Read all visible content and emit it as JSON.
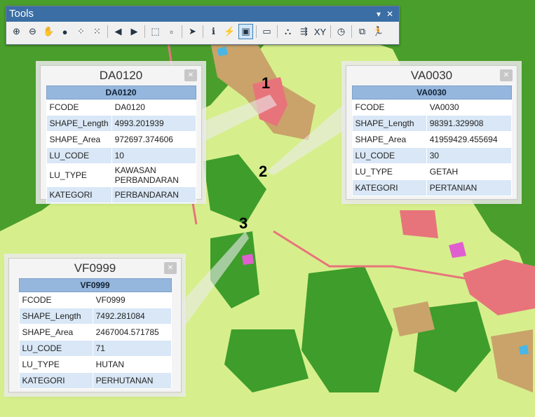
{
  "toolbar": {
    "title": "Tools",
    "menu_glyph": "▾",
    "close_glyph": "✕",
    "buttons": [
      {
        "name": "zoom-in-icon",
        "glyph": "⊕"
      },
      {
        "name": "zoom-out-icon",
        "glyph": "⊖"
      },
      {
        "name": "pan-icon",
        "glyph": "✋"
      },
      {
        "name": "full-extent-icon",
        "glyph": "●"
      },
      {
        "name": "fixed-zoom-in-icon",
        "glyph": "⁘"
      },
      {
        "name": "fixed-zoom-out-icon",
        "glyph": "⁙"
      },
      {
        "name": "sep"
      },
      {
        "name": "back-extent-icon",
        "glyph": "◀"
      },
      {
        "name": "forward-extent-icon",
        "glyph": "▶"
      },
      {
        "name": "sep"
      },
      {
        "name": "select-features-icon",
        "glyph": "⬚"
      },
      {
        "name": "clear-selection-icon",
        "glyph": "▫"
      },
      {
        "name": "sep"
      },
      {
        "name": "select-elements-icon",
        "glyph": "➤"
      },
      {
        "name": "sep"
      },
      {
        "name": "identify-icon",
        "glyph": "ℹ"
      },
      {
        "name": "hyperlink-icon",
        "glyph": "⚡"
      },
      {
        "name": "html-popup-icon",
        "glyph": "▣",
        "active": true
      },
      {
        "name": "sep"
      },
      {
        "name": "measure-icon",
        "glyph": "▭"
      },
      {
        "name": "sep"
      },
      {
        "name": "find-icon",
        "glyph": "⛬"
      },
      {
        "name": "find-route-icon",
        "glyph": "⇶"
      },
      {
        "name": "go-to-xy-icon",
        "glyph": "XY"
      },
      {
        "name": "sep"
      },
      {
        "name": "time-slider-icon",
        "glyph": "◷"
      },
      {
        "name": "sep"
      },
      {
        "name": "viewer-window-icon",
        "glyph": "⧉"
      },
      {
        "name": "route-runner-icon",
        "glyph": "🏃"
      }
    ]
  },
  "popups": [
    {
      "title": "DA0120",
      "header": "DA0120",
      "rows": [
        {
          "field": "FCODE",
          "value": "DA0120"
        },
        {
          "field": "SHAPE_Length",
          "value": "4993.201939"
        },
        {
          "field": "SHAPE_Area",
          "value": "972697.374606"
        },
        {
          "field": "LU_CODE",
          "value": "10"
        },
        {
          "field": "LU_TYPE",
          "value": "KAWASAN PERBANDARAN"
        },
        {
          "field": "KATEGORI",
          "value": "PERBANDARAN"
        }
      ]
    },
    {
      "title": "VA0030",
      "header": "VA0030",
      "rows": [
        {
          "field": "FCODE",
          "value": "VA0030"
        },
        {
          "field": "SHAPE_Length",
          "value": "98391.329908"
        },
        {
          "field": "SHAPE_Area",
          "value": "41959429.455694"
        },
        {
          "field": "LU_CODE",
          "value": "30"
        },
        {
          "field": "LU_TYPE",
          "value": "GETAH"
        },
        {
          "field": "KATEGORI",
          "value": "PERTANIAN"
        }
      ]
    },
    {
      "title": "VF0999",
      "header": "VF0999",
      "rows": [
        {
          "field": "FCODE",
          "value": "VF0999"
        },
        {
          "field": "SHAPE_Length",
          "value": "7492.281084"
        },
        {
          "field": "SHAPE_Area",
          "value": "2467004.571785"
        },
        {
          "field": "LU_CODE",
          "value": "71"
        },
        {
          "field": "LU_TYPE",
          "value": "HUTAN"
        },
        {
          "field": "KATEGORI",
          "value": "PERHUTANAN"
        }
      ]
    }
  ],
  "markers": [
    "1",
    "2",
    "3"
  ],
  "colors": {
    "forest": "#3c9b2a",
    "agriculture": "#d7f08a",
    "urban": "#e9737a",
    "orchard": "#c9a36a",
    "water": "#49b6e6",
    "magenta": "#e05fd0"
  }
}
